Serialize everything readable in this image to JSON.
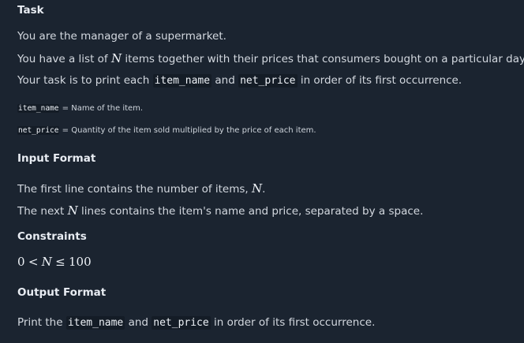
{
  "task": {
    "title": "Task",
    "line1": "You are the manager of a supermarket.",
    "line2_a": "You have a list of",
    "line2_var": "N",
    "line2_b": "items together with their prices that consumers bought on a particular day.",
    "line3_a": "Your task is to print each",
    "line3_code1": "item_name",
    "line3_b": "and",
    "line3_code2": "net_price",
    "line3_c": "in order of its first occurrence."
  },
  "definitions": [
    {
      "code": "item_name",
      "text": "= Name of the item."
    },
    {
      "code": "net_price",
      "text": "= Quantity of the item sold multiplied by the price of each item."
    }
  ],
  "input_format": {
    "title": "Input Format",
    "line1_a": "The first line contains the number of items,",
    "line1_var": "N",
    "line1_b": ".",
    "line2_a": "The next",
    "line2_var": "N",
    "line2_b": "lines contains the item's name and price, separated by a space."
  },
  "constraints": {
    "title": "Constraints",
    "lower": "0",
    "op1": "<",
    "var": "N",
    "op2": "≤",
    "upper": "100"
  },
  "output_format": {
    "title": "Output Format",
    "line_a": "Print the",
    "code1": "item_name",
    "line_b": "and",
    "code2": "net_price",
    "line_c": "in order of its first occurrence."
  }
}
